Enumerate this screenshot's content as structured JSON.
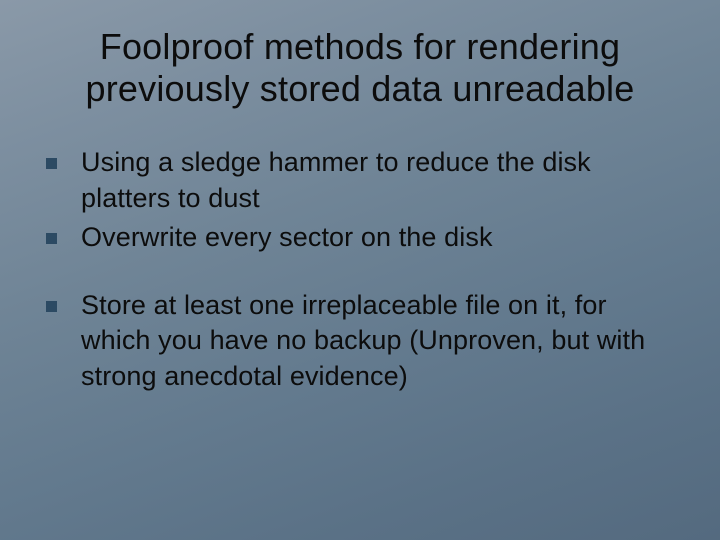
{
  "slide": {
    "title": "Foolproof methods for rendering previously stored data unreadable",
    "bullets": [
      {
        "text": "Using a sledge hammer to reduce the disk platters to dust",
        "gap": false
      },
      {
        "text": "Overwrite every sector on the disk",
        "gap": false
      },
      {
        "text": "Store at least one irreplaceable file on it, for which you have no backup (Unproven, but with strong anecdotal evidence)",
        "gap": true
      }
    ]
  },
  "colors": {
    "bullet_square": "#2c4a63"
  }
}
